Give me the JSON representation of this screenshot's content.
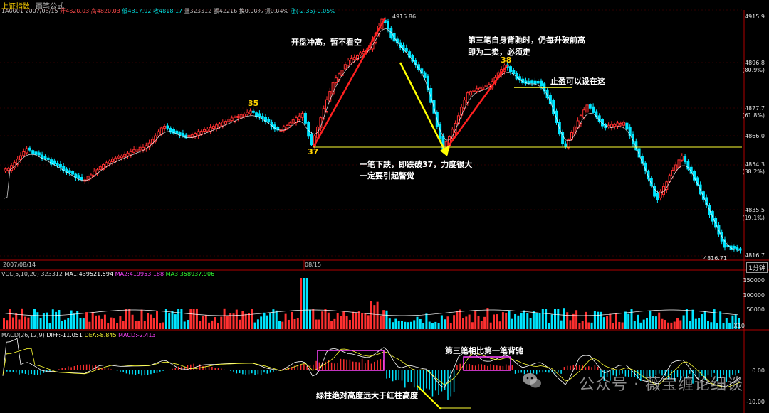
{
  "header": {
    "title": "上证指数",
    "subtitle": "画笔公式"
  },
  "info_bar": {
    "code_date": "1A0001 2007/08/15",
    "open": "开4820.03",
    "high": "高4820.03",
    "low": "低4817.92",
    "close": "收4818.17",
    "volume": "量323312",
    "amount": "额42216",
    "turnover": "换0.00%",
    "amplitude": "振0.04%",
    "change": "涨(-2.35)-0.05%"
  },
  "price_axis": {
    "labels": [
      "4915.9",
      "4896.8",
      "4877.7",
      "4866.0",
      "4854.3",
      "4835.5",
      "4816.7"
    ],
    "pct_labels": [
      "(80.9%)",
      "(61.8%)",
      "(38.2%)",
      "(19.1%)"
    ]
  },
  "price_marks": {
    "high_label": "4915.86",
    "low_label": "4816.71"
  },
  "time_axis": {
    "start": "2007/08/14",
    "mid": "08/15",
    "period": "1分钟"
  },
  "volume_panel": {
    "label": "VOL(5,10,20)",
    "value": "323312",
    "ma1": "MA1:439521.594",
    "ma2": "MA2:419953.188",
    "ma3": "MA3:358937.906",
    "axis": [
      "150000",
      "100000",
      "50000"
    ],
    "unit": "X10"
  },
  "macd_panel": {
    "label": "MACD(26,12,9)",
    "diff": "DIFF:-11.051",
    "dea": "DEA:-8.845",
    "macd": "MACD:-2.413",
    "axis": [
      "0.00",
      "-10.00"
    ]
  },
  "annotations": {
    "a1": "开盘冲高，暂不看空",
    "a2_line1": "第三笔自身背驰时，仍每升破前高",
    "a2_line2": "即为二卖，必须走",
    "a3": "止盈可以设在这",
    "a4_line1": "一笔下跌，即跌破37，力度很大",
    "a4_line2": "一定要引起警觉",
    "a5": "第三笔相比第一笔背驰",
    "a6": "绿柱绝对高度远大于红柱高度",
    "n35": "35",
    "n37": "37",
    "n38": "38"
  },
  "watermark": "公众号 · 薇宝缠论细谈",
  "colors": {
    "up": "#ff3030",
    "down": "#00e5ff",
    "ma": "#ffffff",
    "support": "#ffff33",
    "stroke_up": "#ff2020",
    "stroke_down": "#ffff00",
    "box": "#ff44ff"
  }
}
